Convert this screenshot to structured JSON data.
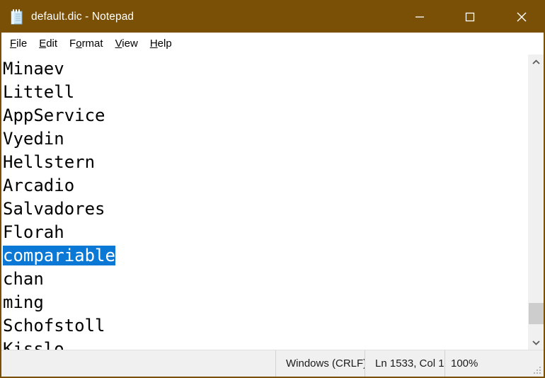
{
  "window": {
    "title": "default.dic - Notepad",
    "app_icon": "notepad-icon",
    "titlebar_color": "#7a5006",
    "selection_color": "#0a78d4"
  },
  "window_controls": {
    "minimize_label": "—",
    "maximize_label": "□",
    "close_label": "✕"
  },
  "menu": {
    "items": [
      {
        "label": "File",
        "accesskey": "F"
      },
      {
        "label": "Edit",
        "accesskey": "E"
      },
      {
        "label": "Format",
        "accesskey": "o"
      },
      {
        "label": "View",
        "accesskey": "V"
      },
      {
        "label": "Help",
        "accesskey": "H"
      }
    ]
  },
  "document": {
    "lines": [
      {
        "text": "Minaev",
        "selected": false
      },
      {
        "text": "Littell",
        "selected": false
      },
      {
        "text": "AppService",
        "selected": false
      },
      {
        "text": "Vyedin",
        "selected": false
      },
      {
        "text": "Hellstern",
        "selected": false
      },
      {
        "text": "Arcadio",
        "selected": false
      },
      {
        "text": "Salvadores",
        "selected": false
      },
      {
        "text": "Florah",
        "selected": false
      },
      {
        "text": "compariable",
        "selected": true
      },
      {
        "text": "chan",
        "selected": false
      },
      {
        "text": "ming",
        "selected": false
      },
      {
        "text": "Schofstoll",
        "selected": false
      },
      {
        "text": "Kisslo",
        "selected": false
      }
    ]
  },
  "scrollbar": {
    "up_arrow": "chevron-up-icon",
    "down_arrow": "chevron-down-icon",
    "thumb_top_pct": 88,
    "thumb_height_pct": 8
  },
  "statusbar": {
    "empty": "",
    "line_ending": "Windows (CRLF)",
    "cursor_position": "Ln 1533, Col 1",
    "zoom": "100%"
  }
}
